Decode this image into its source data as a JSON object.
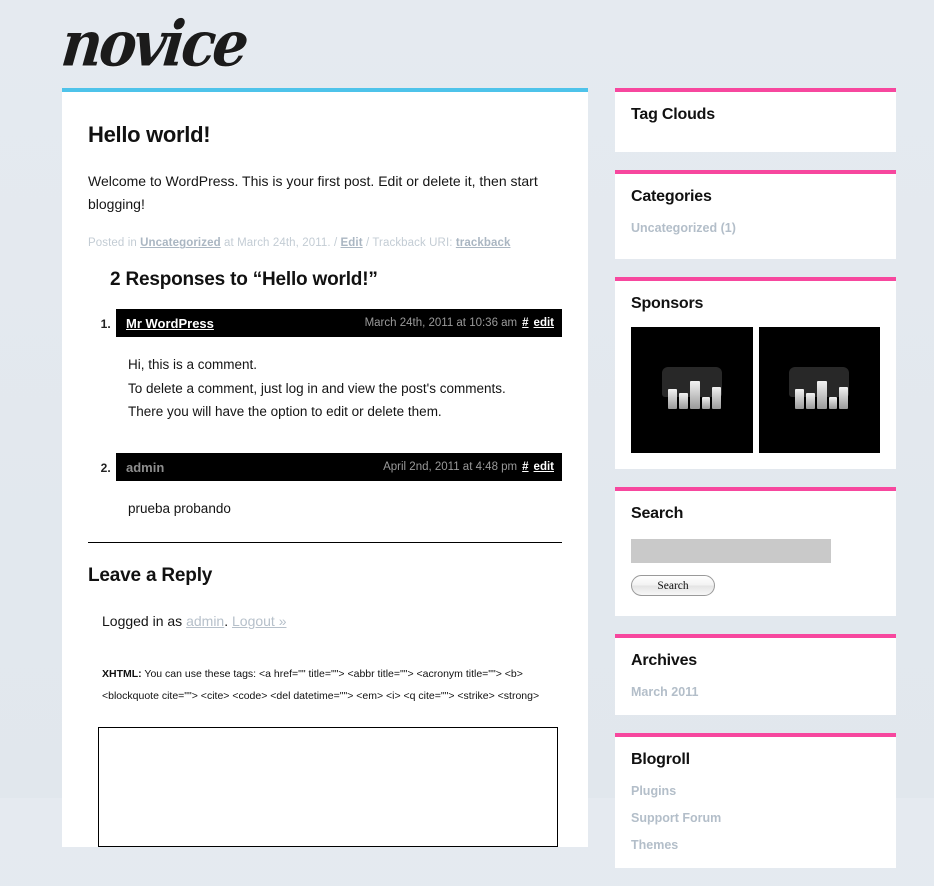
{
  "site": {
    "logo_text": "novice",
    "accent_top": "#4ec3ea",
    "accent_sidebar": "#f7479e",
    "background": "#e3e9ef"
  },
  "post": {
    "title": "Hello world!",
    "body": "Welcome to WordPress. This is your first post. Edit or delete it, then start blogging!",
    "meta": {
      "posted_in_label": "Posted in",
      "category": "Uncategorized",
      "at_label": "at",
      "date": "March 24th, 2011.",
      "sep1": "/",
      "edit_label": "Edit",
      "sep2": "/",
      "trackback_label": "Trackback URI:",
      "trackback_link": "trackback"
    }
  },
  "comments": {
    "heading": "2 Responses to “Hello world!”",
    "items": [
      {
        "author": "Mr WordPress",
        "author_is_link": true,
        "date": "March 24th, 2011 at 10:36 am",
        "hash_label": "#",
        "edit_label": "edit",
        "lines": [
          "Hi, this is a comment.",
          "To delete a comment, just log in and view the post's comments.",
          "There you will have the option to edit or delete them."
        ]
      },
      {
        "author": "admin",
        "author_is_link": false,
        "date": "April 2nd, 2011 at 4:48 pm",
        "hash_label": "#",
        "edit_label": "edit",
        "lines": [
          "prueba probando"
        ]
      }
    ]
  },
  "reply": {
    "title": "Leave a Reply",
    "logged_in_prefix": "Logged in as",
    "user": "admin",
    "period": ".",
    "logout_label": "Logout »",
    "allowed_tags_label": "XHTML:",
    "allowed_tags_line1": "You can use these tags: <a href=\"\" title=\"\"> <abbr title=\"\"> <acronym title=\"\"> <b>",
    "allowed_tags_line2": "<blockquote cite=\"\"> <cite> <code> <del datetime=\"\"> <em> <i> <q cite=\"\"> <strike> <strong>",
    "comment_value": "",
    "comment_placeholder": ""
  },
  "sidebar": {
    "widgets": [
      {
        "title": "Tag Clouds",
        "items": []
      },
      {
        "title": "Categories",
        "items": [
          "Uncategorized (1)"
        ]
      },
      {
        "title": "Sponsors",
        "items": []
      },
      {
        "title": "Search",
        "items": []
      },
      {
        "title": "Archives",
        "items": [
          "March 2011"
        ]
      },
      {
        "title": "Blogroll",
        "items": [
          "Plugins",
          "Support Forum",
          "Themes"
        ]
      }
    ],
    "sponsors": {
      "title": "Sponsors",
      "thumbs": [
        "sponsor-placeholder-1",
        "sponsor-placeholder-2"
      ]
    },
    "search": {
      "title": "Search",
      "input_value": "",
      "input_placeholder": "",
      "button_label": "Search"
    },
    "tag_clouds": {
      "title": "Tag Clouds"
    },
    "categories": {
      "title": "Categories",
      "items": [
        "Uncategorized (1)"
      ]
    },
    "archives": {
      "title": "Archives",
      "items": [
        "March 2011"
      ]
    },
    "blogroll": {
      "title": "Blogroll",
      "items": [
        "Plugins",
        "Support Forum",
        "Themes"
      ]
    }
  }
}
